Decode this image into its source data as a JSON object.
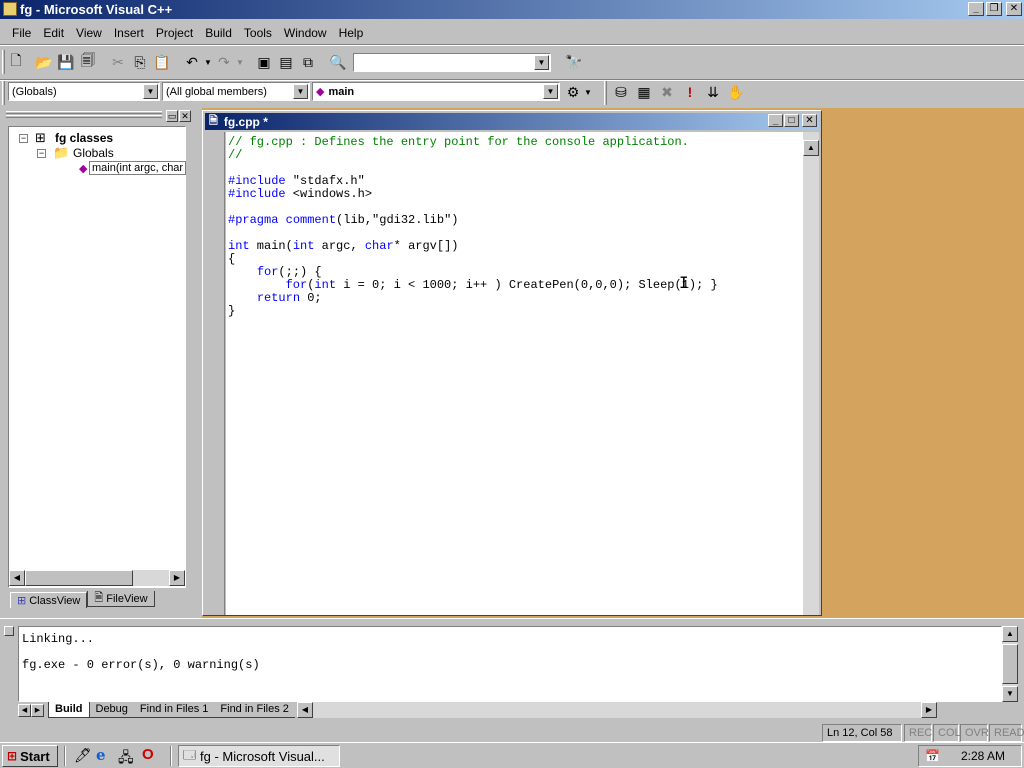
{
  "window": {
    "title": "fg - Microsoft Visual C++"
  },
  "menu": [
    "File",
    "Edit",
    "View",
    "Insert",
    "Project",
    "Build",
    "Tools",
    "Window",
    "Help"
  ],
  "toolbar": {
    "find_combo_value": "",
    "scope_combo": "(Globals)",
    "members_combo": "(All global members)",
    "function_combo": "main"
  },
  "workspace": {
    "root": "fg classes",
    "folder": "Globals",
    "item": "main(int argc, char",
    "tabs": [
      "ClassView",
      "FileView"
    ]
  },
  "editor": {
    "title": "fg.cpp *",
    "lines": [
      [
        {
          "t": "// fg.cpp : Defines the entry point for the console application.",
          "c": "cmt"
        }
      ],
      [
        {
          "t": "//",
          "c": "cmt"
        }
      ],
      [
        {
          "t": "",
          "c": ""
        }
      ],
      [
        {
          "t": "#include",
          "c": "kw"
        },
        {
          "t": " \"stdafx.h\"",
          "c": ""
        }
      ],
      [
        {
          "t": "#include",
          "c": "kw"
        },
        {
          "t": " <windows.h>",
          "c": ""
        }
      ],
      [
        {
          "t": "",
          "c": ""
        }
      ],
      [
        {
          "t": "#pragma",
          "c": "kw"
        },
        {
          "t": " ",
          "c": ""
        },
        {
          "t": "comment",
          "c": "kw"
        },
        {
          "t": "(lib,\"gdi32.lib\")",
          "c": ""
        }
      ],
      [
        {
          "t": "",
          "c": ""
        }
      ],
      [
        {
          "t": "int",
          "c": "kw"
        },
        {
          "t": " main(",
          "c": ""
        },
        {
          "t": "int",
          "c": "kw"
        },
        {
          "t": " argc, ",
          "c": ""
        },
        {
          "t": "char",
          "c": "kw"
        },
        {
          "t": "* argv[])",
          "c": ""
        }
      ],
      [
        {
          "t": "{",
          "c": ""
        }
      ],
      [
        {
          "t": "    ",
          "c": ""
        },
        {
          "t": "for",
          "c": "kw"
        },
        {
          "t": "(;;) {",
          "c": ""
        }
      ],
      [
        {
          "t": "        ",
          "c": ""
        },
        {
          "t": "for",
          "c": "kw"
        },
        {
          "t": "(",
          "c": ""
        },
        {
          "t": "int",
          "c": "kw"
        },
        {
          "t": " i = 0; i < 1000; i++ ) CreatePen(0,0,0); Sleep(1); }",
          "c": ""
        }
      ],
      [
        {
          "t": "    ",
          "c": ""
        },
        {
          "t": "return",
          "c": "kw"
        },
        {
          "t": " 0;",
          "c": ""
        }
      ],
      [
        {
          "t": "}",
          "c": ""
        }
      ]
    ]
  },
  "output": {
    "lines": [
      "Linking...",
      "",
      "fg.exe - 0 error(s), 0 warning(s)"
    ],
    "tabs": [
      "Build",
      "Debug",
      "Find in Files 1",
      "Find in Files 2"
    ]
  },
  "status": {
    "position": "Ln 12, Col 58",
    "indicators": [
      "REC",
      "COL",
      "OVR",
      "READ"
    ]
  },
  "taskbar": {
    "start": "Start",
    "task": "fg - Microsoft Visual...",
    "clock": "2:28 AM"
  },
  "colors": {
    "title_start": "#0a246a",
    "title_end": "#a6caf0",
    "mdi_background": "#d4a35d",
    "comment": "#008000",
    "keyword": "#0000ff"
  }
}
